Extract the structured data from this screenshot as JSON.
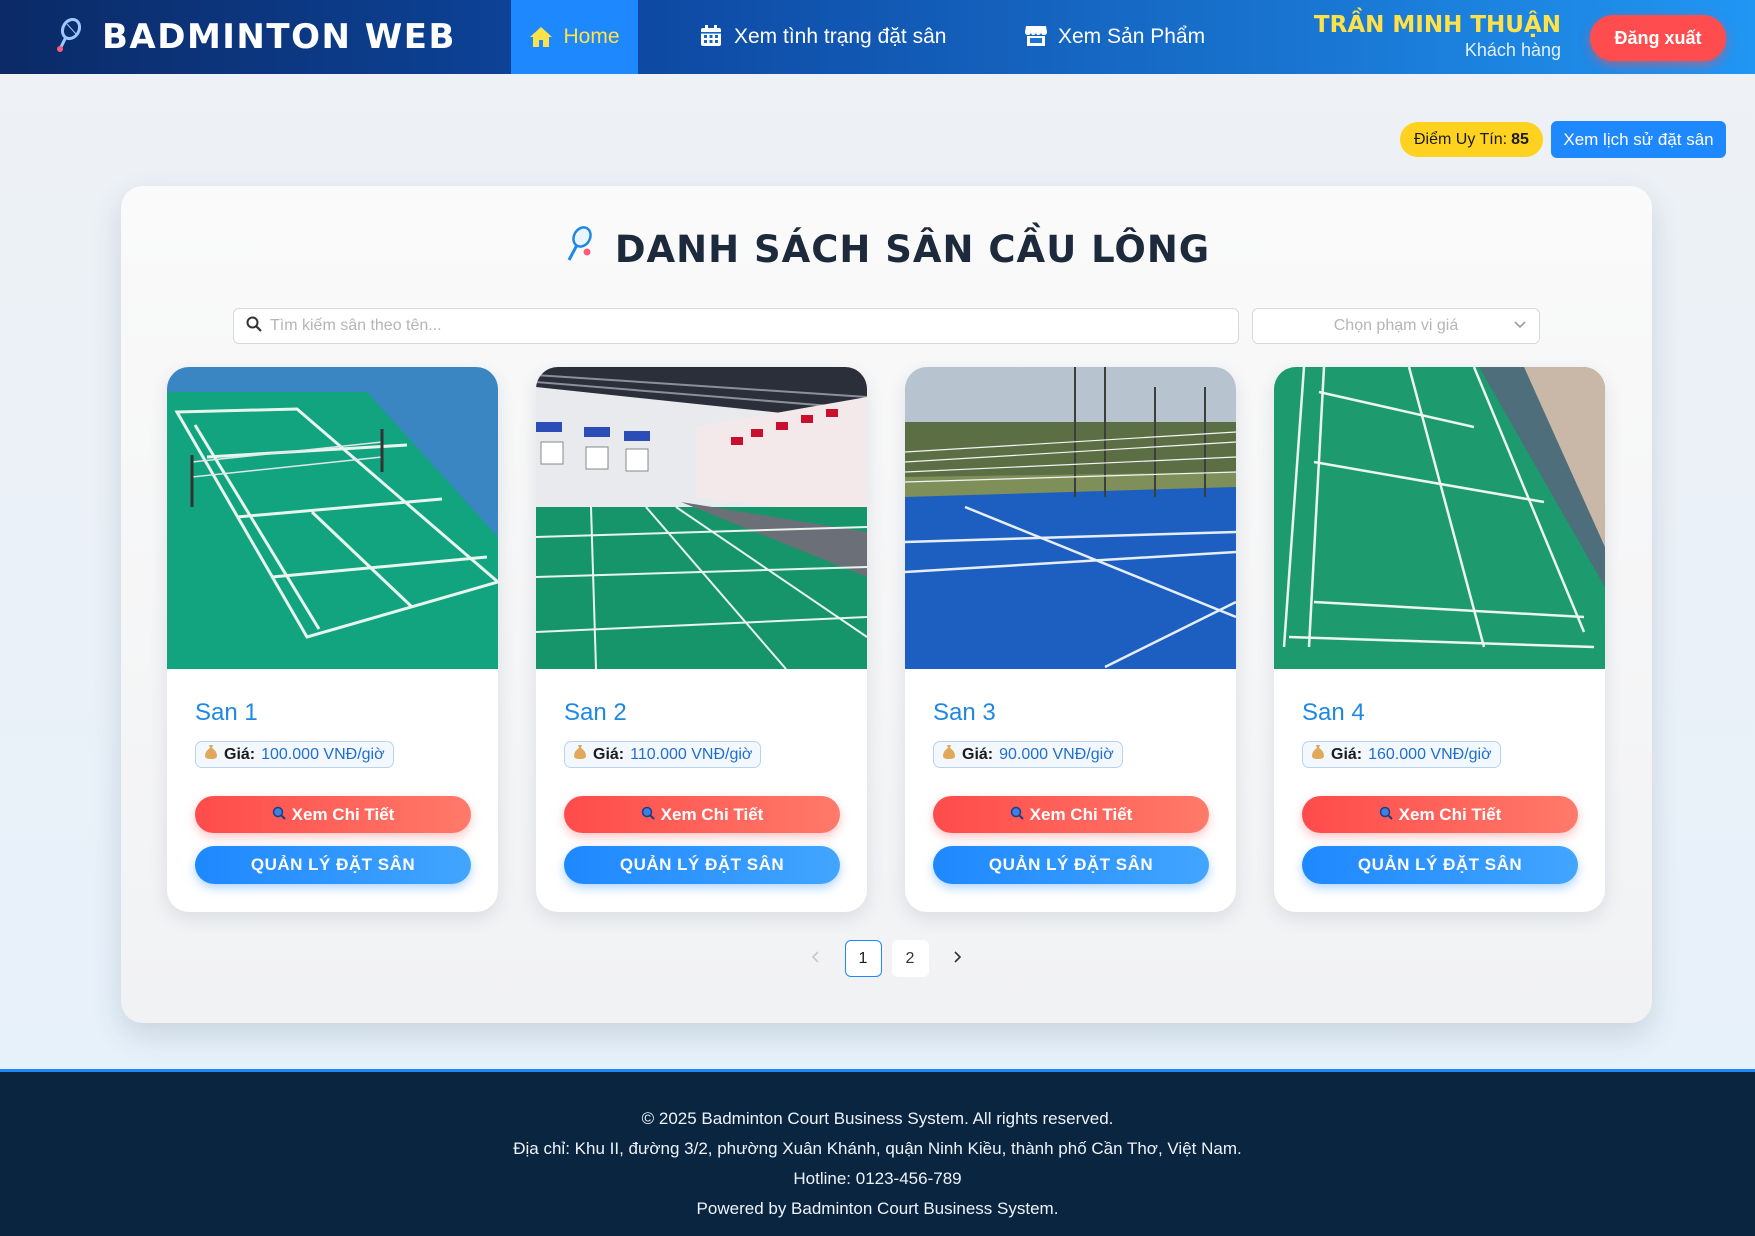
{
  "navbar": {
    "brand": "BADMINTON WEB",
    "items": [
      {
        "label": "Home",
        "icon": "home-icon",
        "active": true
      },
      {
        "label": "Xem tình trạng đặt sân",
        "icon": "calendar-icon",
        "active": false
      },
      {
        "label": "Xem Sản Phẩm",
        "icon": "store-icon",
        "active": false
      }
    ],
    "user_name": "TRẦN MINH THUẬN",
    "user_role": "Khách hàng",
    "logout_label": "Đăng xuất"
  },
  "top_actions": {
    "reputation_label": "Điểm Uy Tín:",
    "reputation_value": "85",
    "history_label": "Xem lịch sử đặt sân"
  },
  "main": {
    "title": "DANH SÁCH SÂN CẦU LÔNG",
    "search_placeholder": "Tìm kiếm sân theo tên...",
    "price_select_placeholder": "Chọn phạm vi giá"
  },
  "courts": [
    {
      "name": "San 1",
      "price_label": "Giá:",
      "price": "100.000 VNĐ/giờ",
      "detail_label": "Xem Chi Tiết",
      "manage_label": "QUẢN LÝ ĐẶT SÂN"
    },
    {
      "name": "San 2",
      "price_label": "Giá:",
      "price": "110.000 VNĐ/giờ",
      "detail_label": "Xem Chi Tiết",
      "manage_label": "QUẢN LÝ ĐẶT SÂN"
    },
    {
      "name": "San 3",
      "price_label": "Giá:",
      "price": "90.000 VNĐ/giờ",
      "detail_label": "Xem Chi Tiết",
      "manage_label": "QUẢN LÝ ĐẶT SÂN"
    },
    {
      "name": "San 4",
      "price_label": "Giá:",
      "price": "160.000 VNĐ/giờ",
      "detail_label": "Xem Chi Tiết",
      "manage_label": "QUẢN LÝ ĐẶT SÂN"
    }
  ],
  "pagination": {
    "pages": [
      "1",
      "2"
    ],
    "current": "1"
  },
  "footer": {
    "line1": "© 2025 Badminton Court Business System. All rights reserved.",
    "line2": "Địa chỉ: Khu II, đường 3/2, phường Xuân Khánh, quận Ninh Kiều, thành phố Cần Thơ, Việt Nam.",
    "line3": "Hotline: 0123-456-789",
    "line4": "Powered by Badminton Court Business System."
  },
  "colors": {
    "primary": "#1e88ff",
    "danger": "#ff4d4f",
    "accent_yellow": "#ffe14a",
    "footer_bg": "#0a2540"
  }
}
